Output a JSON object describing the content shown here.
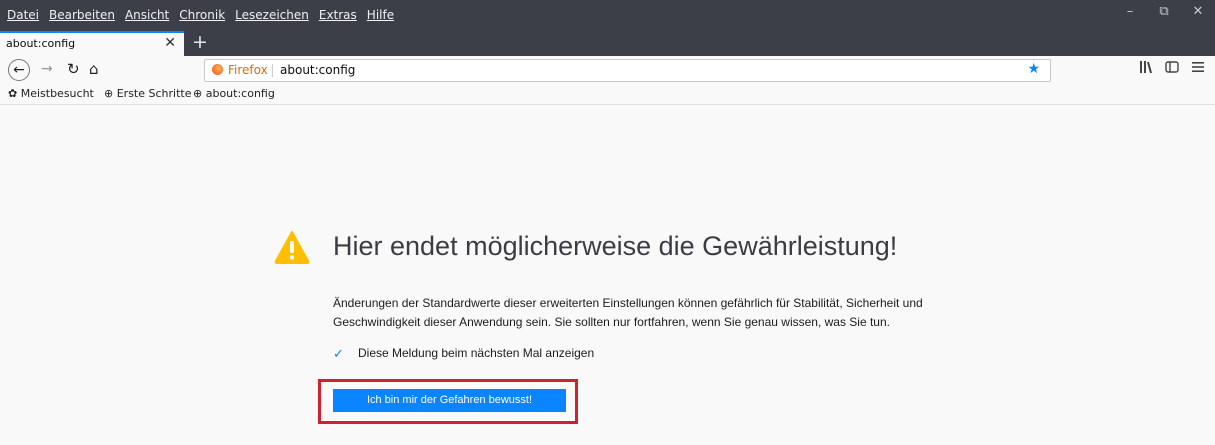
{
  "menubar": [
    "Datei",
    "Bearbeiten",
    "Ansicht",
    "Chronik",
    "Lesezeichen",
    "Extras",
    "Hilfe"
  ],
  "window_controls": {
    "minimize": "–",
    "restore": "⧉",
    "close": "✕"
  },
  "tab": {
    "title": "about:config",
    "close": "✕",
    "new_tab": "+"
  },
  "navbar": {
    "back": "←",
    "forward": "→",
    "reload": "↻",
    "home": "⌂",
    "identity": "Firefox",
    "url": "about:config",
    "bookmark_star": "★"
  },
  "bookmarks": [
    {
      "icon": "✿",
      "label": "Meistbesucht"
    },
    {
      "icon": "⊕",
      "label": "Erste Schritte"
    },
    {
      "icon": "⊕",
      "label": "about:config"
    }
  ],
  "page": {
    "headline": "Hier endet möglicherweise die Gewährleistung!",
    "description": "Änderungen der Standardwerte dieser erweiterten Einstellungen können gefährlich für Stabilität, Sicherheit und Geschwindigkeit dieser Anwendung sein. Sie sollten nur fortfahren, wenn Sie genau wissen, was Sie tun.",
    "checkbox_label": "Diese Meldung beim nächsten Mal anzeigen",
    "checkbox_checked": true,
    "accept_button": "Ich bin mir der Gefahren bewusst!"
  },
  "colors": {
    "accent": "#0a84ff",
    "warning": "#ffbf00",
    "highlight": "#d0212d",
    "chrome_dark": "#3d3f48"
  }
}
